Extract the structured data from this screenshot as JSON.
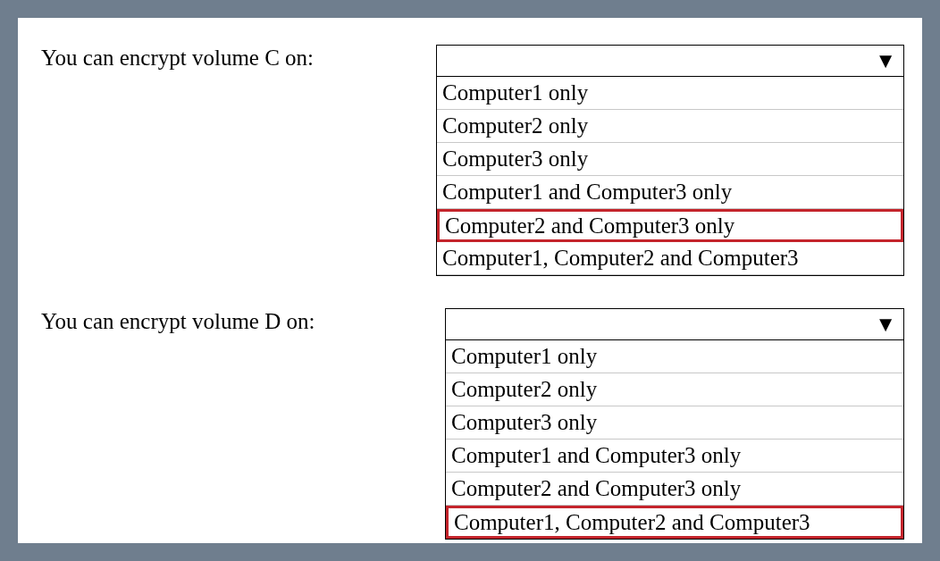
{
  "questions": [
    {
      "label": "You can encrypt volume C on:",
      "arrow": "▼",
      "options": [
        {
          "text": "Computer1 only",
          "selected": false
        },
        {
          "text": "Computer2 only",
          "selected": false
        },
        {
          "text": "Computer3 only",
          "selected": false
        },
        {
          "text": "Computer1 and Computer3 only",
          "selected": false
        },
        {
          "text": "Computer2 and Computer3 only",
          "selected": true
        },
        {
          "text": "Computer1, Computer2 and Computer3",
          "selected": false
        }
      ]
    },
    {
      "label": "You can encrypt volume D on:",
      "arrow": "▼",
      "options": [
        {
          "text": "Computer1 only",
          "selected": false
        },
        {
          "text": "Computer2 only",
          "selected": false
        },
        {
          "text": "Computer3 only",
          "selected": false
        },
        {
          "text": "Computer1 and Computer3 only",
          "selected": false
        },
        {
          "text": "Computer2 and Computer3 only",
          "selected": false
        },
        {
          "text": "Computer1, Computer2 and Computer3",
          "selected": true
        }
      ]
    }
  ]
}
